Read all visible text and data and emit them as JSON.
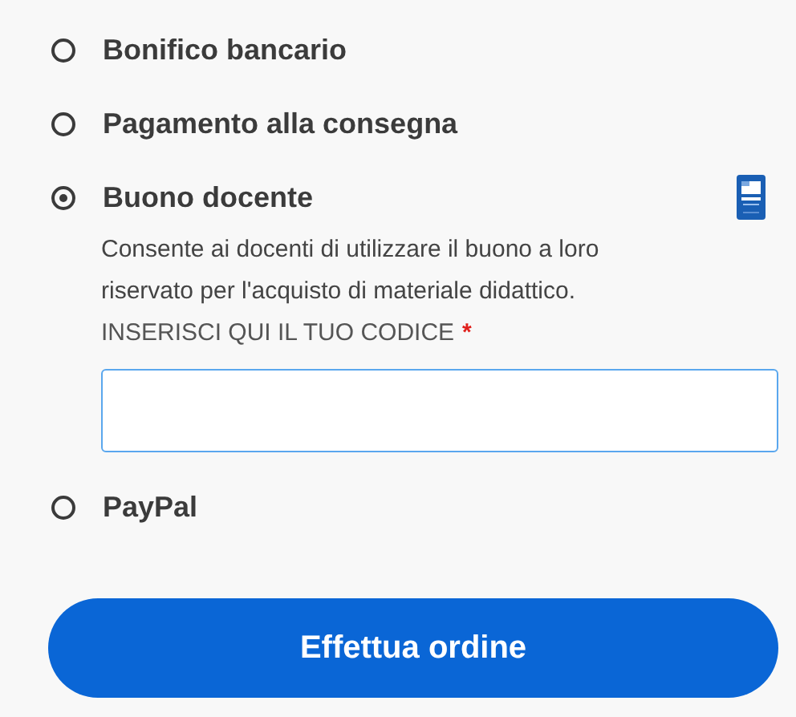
{
  "payment_methods": [
    {
      "label": "Bonifico bancario",
      "selected": false
    },
    {
      "label": "Pagamento alla consegna",
      "selected": false
    },
    {
      "label": "Buono docente",
      "selected": true,
      "has_logo": true,
      "description": "Consente ai docenti di utilizzare il buono a loro riservato per l'acquisto di materiale didattico.",
      "code_field": {
        "label": "INSERISCI QUI IL TUO CODICE",
        "required_mark": "*"
      }
    },
    {
      "label": "PayPal",
      "selected": false
    }
  ],
  "submit_button": "Effettua ordine"
}
